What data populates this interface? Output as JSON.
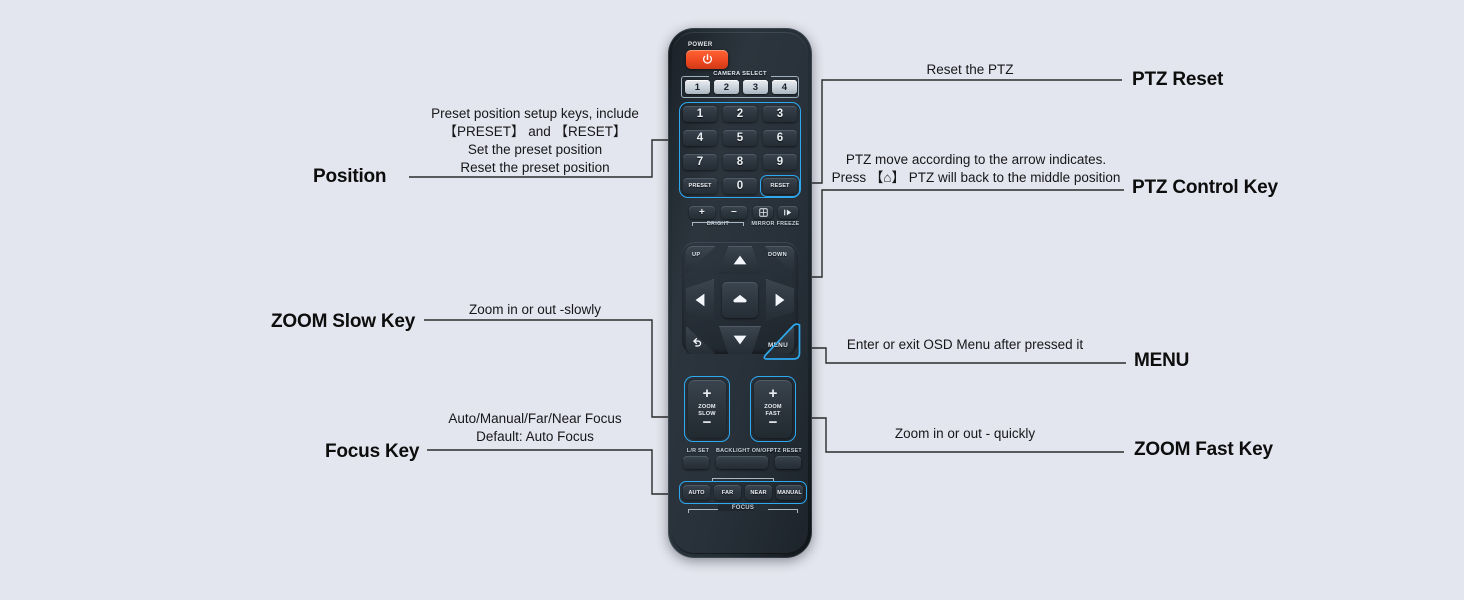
{
  "background_color": "#e4e6ef",
  "accent_highlight_color": "#2ea8ef",
  "power_button_color": "#ee4a22",
  "callouts": {
    "position": {
      "title": "Position",
      "lines": [
        "Preset position setup keys, include",
        "【PRESET】 and 【RESET】",
        "Set the preset position",
        "Reset the preset position"
      ]
    },
    "zoom_slow": {
      "title": "ZOOM Slow Key",
      "lines": [
        "Zoom in or out -slowly"
      ]
    },
    "focus": {
      "title": "Focus Key",
      "lines": [
        "Auto/Manual/Far/Near    Focus",
        "Default:  Auto  Focus"
      ]
    },
    "ptz_reset": {
      "title": "PTZ Reset",
      "lines": [
        "Reset  the  PTZ"
      ]
    },
    "ptz_control": {
      "title": "PTZ Control Key",
      "lines": [
        "PTZ move according to the arrow  indicates.",
        "Press 【⌂】 PTZ will back to the middle position"
      ]
    },
    "menu": {
      "title": "MENU",
      "lines": [
        "Enter or exit OSD Menu after pressed it"
      ]
    },
    "zoom_fast": {
      "title": "ZOOM Fast Key",
      "lines": [
        "Zoom in or out - quickly"
      ]
    }
  },
  "remote": {
    "power_label": "POWER",
    "camera_select_label": "CAMERA SELECT",
    "camera_buttons": [
      "1",
      "2",
      "3",
      "4"
    ],
    "keypad": [
      [
        "1",
        "2",
        "3"
      ],
      [
        "4",
        "5",
        "6"
      ],
      [
        "7",
        "8",
        "9"
      ],
      [
        "PRESET",
        "0",
        "RESET"
      ]
    ],
    "function_row": {
      "bright_plus": "+",
      "bright_minus": "−",
      "bright_label": "BRIGHT",
      "mirror_label": "MIRROR",
      "freeze_label": "FREEZE"
    },
    "dpad": {
      "up_corner": "UP",
      "down_corner": "DOWN",
      "home_icon": "home-icon",
      "back_icon": "back-arrow-icon",
      "menu_label": "MENU"
    },
    "zoom_slow": {
      "plus": "+",
      "minus": "−",
      "line1": "ZOOM",
      "line2": "SLOW"
    },
    "zoom_fast": {
      "plus": "+",
      "minus": "−",
      "line1": "ZOOM",
      "line2": "FAST"
    },
    "aux_row": {
      "lr_set": "L/R SET",
      "backlight": "BACKLIGHT ON/OFF",
      "ptz_reset": "PTZ RESET"
    },
    "focus_row": {
      "buttons": [
        "AUTO",
        "FAR",
        "NEAR",
        "MANUAL"
      ],
      "group_label": "FOCUS"
    }
  }
}
